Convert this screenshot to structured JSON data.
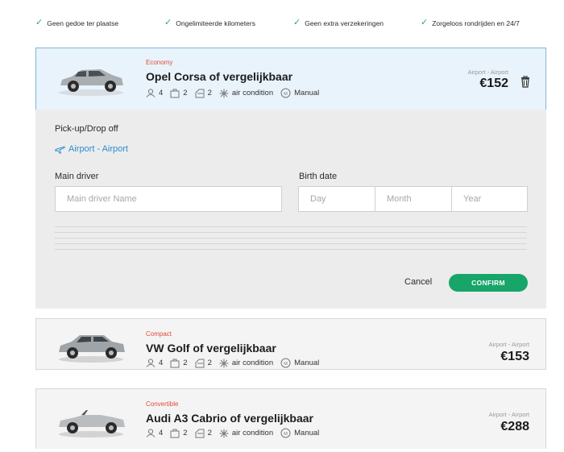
{
  "benefits": [
    {
      "label": "Geen gedoe ter plaatse"
    },
    {
      "label": "Ongelimiteerde kilometers"
    },
    {
      "label": "Geen extra verzekeringen"
    },
    {
      "label": "Zorgeloos rondrijden en 24/7"
    }
  ],
  "cars": [
    {
      "category": "Economy",
      "name": "Opel Corsa of vergelijkbaar",
      "passengers": "4",
      "suitcases": "2",
      "doors": "2",
      "ac": "air condition",
      "transmission": "Manual",
      "route": "Airport - Airport",
      "price": "€152",
      "color": "#a9aeb3"
    },
    {
      "category": "Compact",
      "name": "VW Golf of vergelijkbaar",
      "passengers": "4",
      "suitcases": "2",
      "doors": "2",
      "ac": "air condition",
      "transmission": "Manual",
      "route": "Airport - Airport",
      "price": "€153",
      "color": "#9ea4a8"
    },
    {
      "category": "Convertible",
      "name": "Audi A3 Cabrio of vergelijkbaar",
      "passengers": "4",
      "suitcases": "2",
      "doors": "2",
      "ac": "air condition",
      "transmission": "Manual",
      "route": "Airport - Airport",
      "price": "€288",
      "color": "#b9bdc0"
    }
  ],
  "form": {
    "pickup_label": "Pick-up/Drop off",
    "pickup_value": "Airport - Airport",
    "driver_label": "Main driver",
    "driver_placeholder": "Main driver Name",
    "birth_label": "Birth date",
    "day_placeholder": "Day",
    "month_placeholder": "Month",
    "year_placeholder": "Year",
    "cancel_label": "Cancel",
    "confirm_label": "CONFIRM"
  },
  "colors": {
    "accent_green": "#17a56a",
    "link_blue": "#2a8ed0",
    "category_red": "#e14b3b"
  }
}
